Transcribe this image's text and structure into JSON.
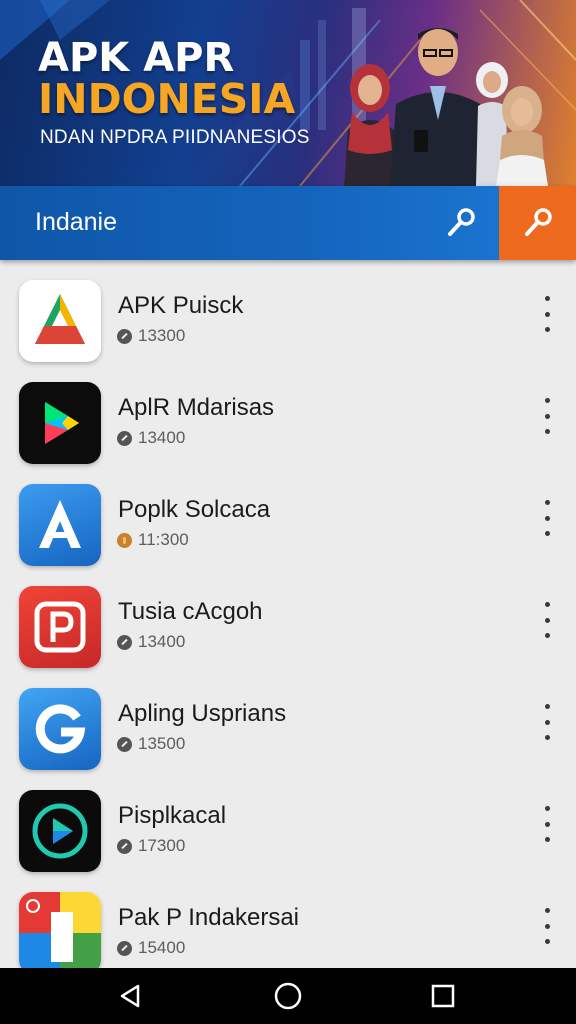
{
  "banner": {
    "title_line1": "APK APR",
    "title_line2": "INDONESIA",
    "subtitle": "NDAN NPDRA PIIDNANESIOS",
    "colors": {
      "title": "#ffffff",
      "title_accent": "#f6a623"
    }
  },
  "header": {
    "title": "Indanie",
    "buttons": [
      {
        "icon": "wrench-icon",
        "color": "#1465bd"
      },
      {
        "icon": "wrench-icon",
        "color": "#ee6a1f"
      }
    ]
  },
  "apps": [
    {
      "name": "APK Puisck",
      "meta": "13300",
      "icon": "triangle-logo-icon",
      "meta_icon": "download-icon"
    },
    {
      "name": "AplR Mdarisas",
      "meta": "13400",
      "icon": "play-store-icon",
      "meta_icon": "download-icon"
    },
    {
      "name": "Poplk Solcaca",
      "meta": "11:300",
      "icon": "letter-a-icon",
      "meta_icon": "coin-icon"
    },
    {
      "name": "Tusia cAcgoh",
      "meta": "13400",
      "icon": "letter-p-icon",
      "meta_icon": "download-icon"
    },
    {
      "name": "Apling Usprians",
      "meta": "13500",
      "icon": "letter-g-icon",
      "meta_icon": "download-icon"
    },
    {
      "name": "Pisplkacal",
      "meta": "17300",
      "icon": "play-circle-icon",
      "meta_icon": "download-icon"
    },
    {
      "name": "Pak P Indakersai",
      "meta": "15400",
      "icon": "colorful-tiles-icon",
      "meta_icon": "download-icon"
    }
  ],
  "navbar": {
    "buttons": [
      "back-icon",
      "home-icon",
      "recents-icon"
    ]
  }
}
